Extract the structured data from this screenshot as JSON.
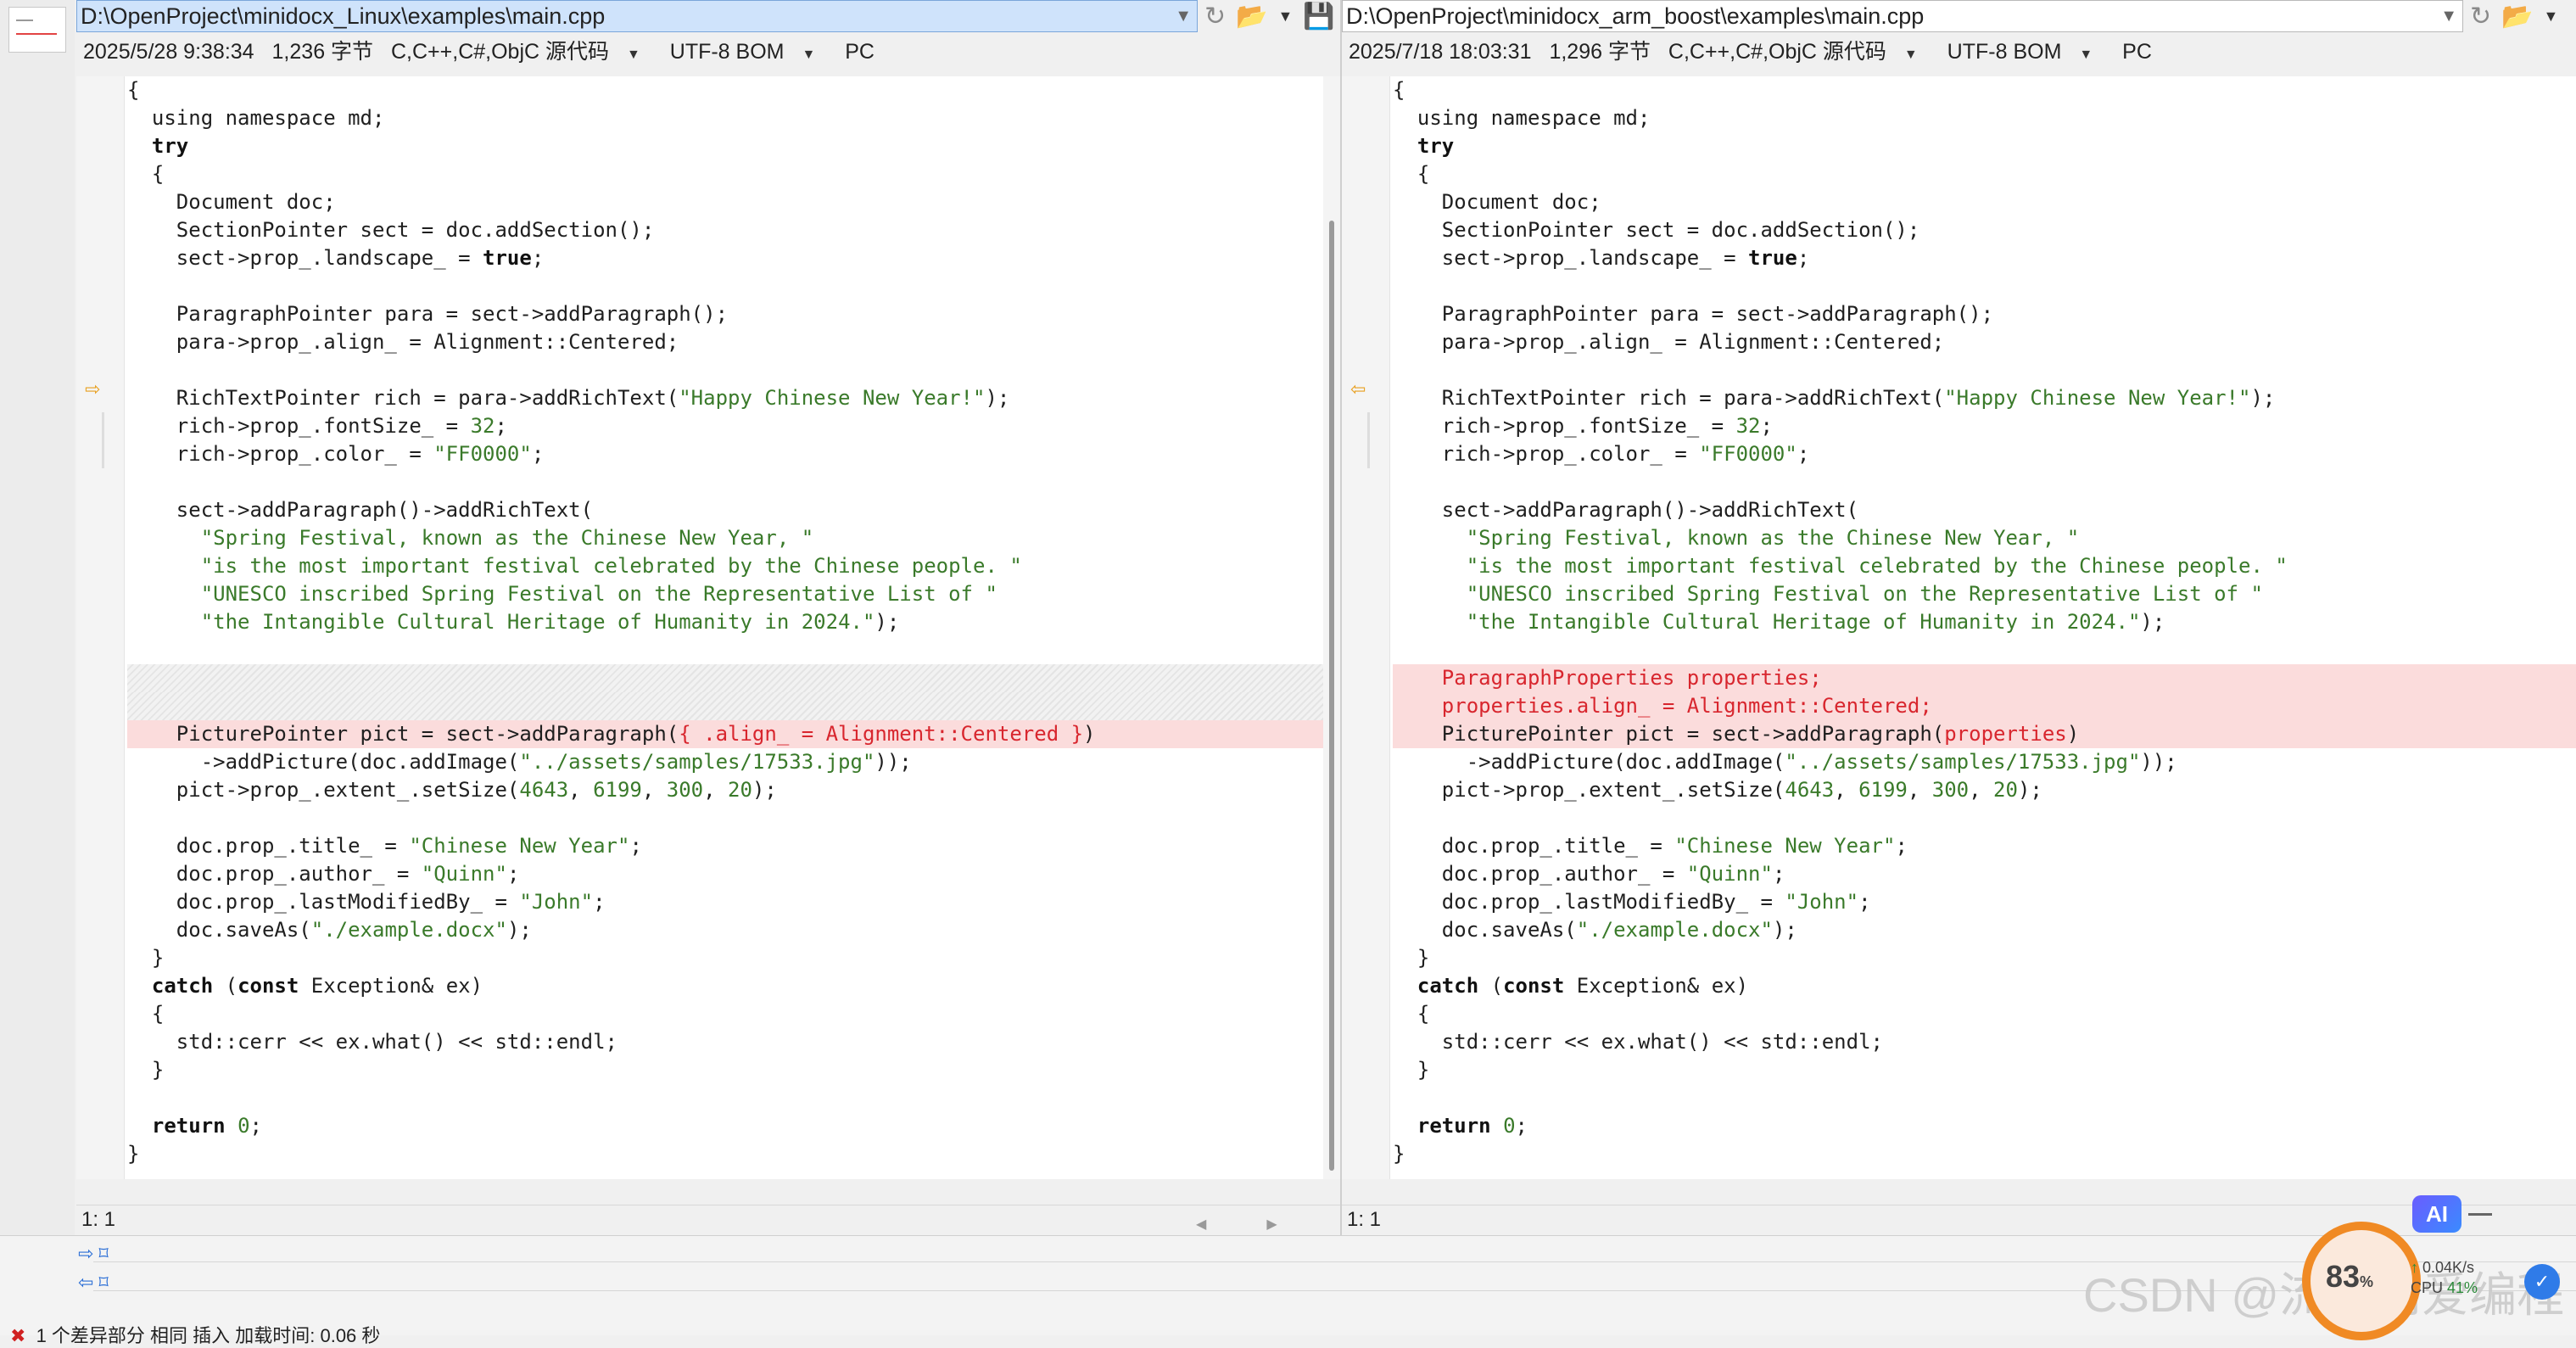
{
  "left": {
    "path": "D:\\OpenProject\\minidocx_Linux\\examples\\main.cpp",
    "date": "2025/5/28 9:38:34",
    "size": "1,236 字节",
    "language": "C,C++,C#,ObjC 源代码",
    "encoding": "UTF-8 BOM",
    "eol": "PC",
    "cursor": "1: 1"
  },
  "right": {
    "path": "D:\\OpenProject\\minidocx_arm_boost\\examples\\main.cpp",
    "date": "2025/7/18 18:03:31",
    "size": "1,296 字节",
    "language": "C,C++,C#,ObjC 源代码",
    "encoding": "UTF-8 BOM",
    "eol": "PC",
    "cursor": "1: 1"
  },
  "overlay": {
    "ai_label": "AI",
    "cpu_percent": "83",
    "percent_sign": "%",
    "net_speed": "0.04K/s",
    "cpu_label": "CPU",
    "cpu_value": "41%",
    "watermark": "CSDN @流星雨爱编程"
  },
  "bottom": {
    "status": "1 个差异部分    相同                    插入        加载时间: 0.06 秒"
  }
}
